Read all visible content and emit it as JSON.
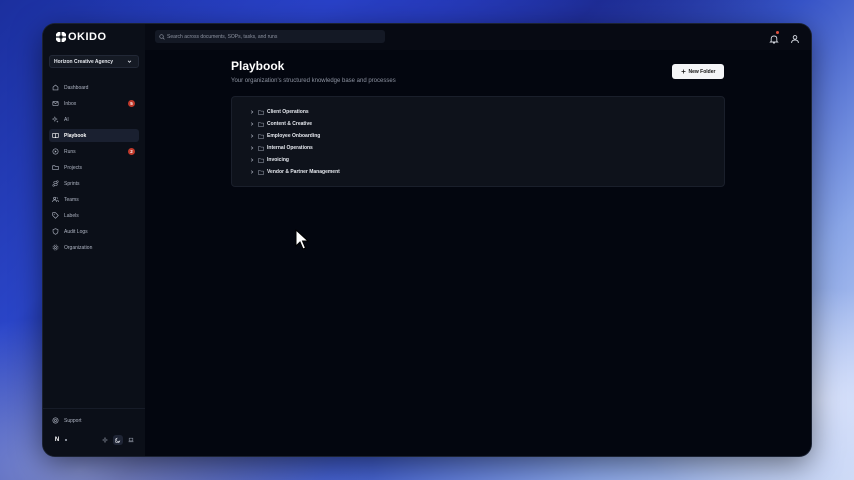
{
  "app": {
    "name": "OKIDO"
  },
  "org_selector": {
    "label": "Horizon Creative Agency"
  },
  "sidebar": {
    "items": [
      {
        "label": "Dashboard",
        "icon": "home-icon",
        "active": false
      },
      {
        "label": "Inbox",
        "icon": "inbox-icon",
        "active": false,
        "badge": "5"
      },
      {
        "label": "AI",
        "icon": "sparkles-icon",
        "active": false
      },
      {
        "label": "Playbook",
        "icon": "book-icon",
        "active": true
      },
      {
        "label": "Runs",
        "icon": "play-circle-icon",
        "active": false,
        "badge": "2"
      },
      {
        "label": "Projects",
        "icon": "folder-icon",
        "active": false
      },
      {
        "label": "Sprints",
        "icon": "route-icon",
        "active": false
      },
      {
        "label": "Teams",
        "icon": "users-icon",
        "active": false
      },
      {
        "label": "Labels",
        "icon": "tag-icon",
        "active": false
      },
      {
        "label": "Audit Logs",
        "icon": "shield-icon",
        "active": false
      },
      {
        "label": "Organization",
        "icon": "gear-icon",
        "active": false
      }
    ],
    "support_label": "Support",
    "avatar_initial": "N"
  },
  "topbar": {
    "search_placeholder": "Search across documents, SOPs, tasks, and runs"
  },
  "main": {
    "title": "Playbook",
    "subtitle": "Your organization's structured knowledge base and processes",
    "new_folder_label": "New Folder",
    "folders": [
      "Client Operations",
      "Content & Creative",
      "Employee Onboarding",
      "Internal Operations",
      "Invoicing",
      "Vendor & Partner Management"
    ]
  },
  "colors": {
    "background": "#03060f",
    "sidebar": "#0b0f18",
    "badge": "#c0392b",
    "text": "#e6e9ef",
    "muted": "#8e94a2"
  }
}
